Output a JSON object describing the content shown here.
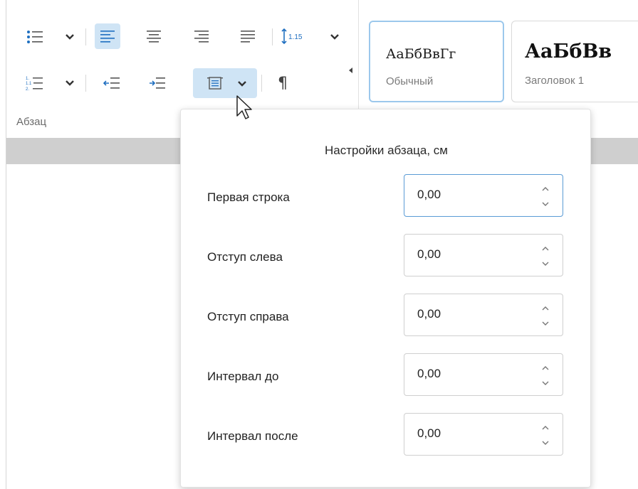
{
  "ribbon": {
    "paragraph_group_label": "Абзац",
    "line_spacing_value": "1.15",
    "buttons": {
      "bulleted_list": "bulleted-list-icon",
      "numbered_list": "numbered-list-icon",
      "align_left": "align-left-icon",
      "align_center": "align-center-icon",
      "align_right": "align-right-icon",
      "justify": "justify-icon",
      "line_spacing": "line-spacing-icon",
      "decrease_indent": "decrease-indent-icon",
      "increase_indent": "increase-indent-icon",
      "paragraph_settings": "paragraph-settings-icon",
      "show_formatting": "pilcrow-icon"
    },
    "styles": [
      {
        "sample": "АаБбВвГг",
        "name": "Обычный",
        "selected": true
      },
      {
        "sample": "АаБбВв",
        "name": "Заголовок 1",
        "selected": false
      }
    ]
  },
  "popup": {
    "title": "Настройки абзаца, см",
    "fields": [
      {
        "label": "Первая строка",
        "value": "0,00",
        "focused": true
      },
      {
        "label": "Отступ слева",
        "value": "0,00",
        "focused": false
      },
      {
        "label": "Отступ справа",
        "value": "0,00",
        "focused": false
      },
      {
        "label": "Интервал до",
        "value": "0,00",
        "focused": false
      },
      {
        "label": "Интервал после",
        "value": "0,00",
        "focused": false
      }
    ]
  },
  "colors": {
    "accent_active": "#cfe4f5",
    "focus_border": "#5a9bd5",
    "icon_blue": "#1f6fc0",
    "icon_gray": "#555555",
    "band_gray": "#cfcfcf"
  }
}
